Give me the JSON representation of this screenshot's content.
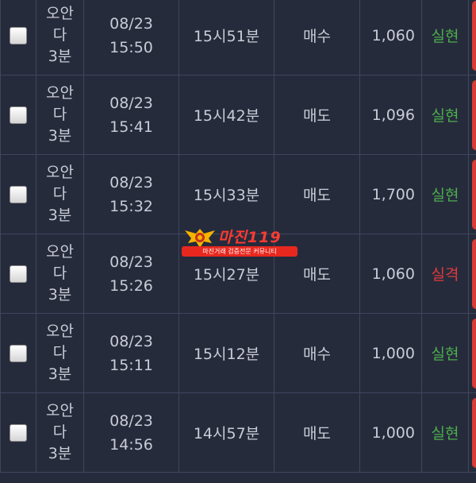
{
  "colors": {
    "background": "#262b3c",
    "grid": "#3f465d",
    "text": "#c9ccd6",
    "win": "#4cae4c",
    "loss": "#e03b3b",
    "edge_button": "#d93c36"
  },
  "watermark": {
    "brand": "마진",
    "brand_suffix": "119",
    "tagline": "마진거래 검증전문 커뮤니티"
  },
  "rows": [
    {
      "name": [
        "오안",
        "다",
        "3분"
      ],
      "date": "08/23",
      "time": "15:50",
      "round": "15시51분",
      "side": "매수",
      "amount": "1,060",
      "result": "실현",
      "result_status": "win"
    },
    {
      "name": [
        "오안",
        "다",
        "3분"
      ],
      "date": "08/23",
      "time": "15:41",
      "round": "15시42분",
      "side": "매도",
      "amount": "1,096",
      "result": "실현",
      "result_status": "win"
    },
    {
      "name": [
        "오안",
        "다",
        "3분"
      ],
      "date": "08/23",
      "time": "15:32",
      "round": "15시33분",
      "side": "매도",
      "amount": "1,700",
      "result": "실현",
      "result_status": "win"
    },
    {
      "name": [
        "오안",
        "다",
        "3분"
      ],
      "date": "08/23",
      "time": "15:26",
      "round": "15시27분",
      "side": "매도",
      "amount": "1,060",
      "result": "실격",
      "result_status": "loss"
    },
    {
      "name": [
        "오안",
        "다",
        "3분"
      ],
      "date": "08/23",
      "time": "15:11",
      "round": "15시12분",
      "side": "매수",
      "amount": "1,000",
      "result": "실현",
      "result_status": "win"
    },
    {
      "name": [
        "오안",
        "다",
        "3분"
      ],
      "date": "08/23",
      "time": "14:56",
      "round": "14시57분",
      "side": "매도",
      "amount": "1,000",
      "result": "실현",
      "result_status": "win"
    }
  ]
}
